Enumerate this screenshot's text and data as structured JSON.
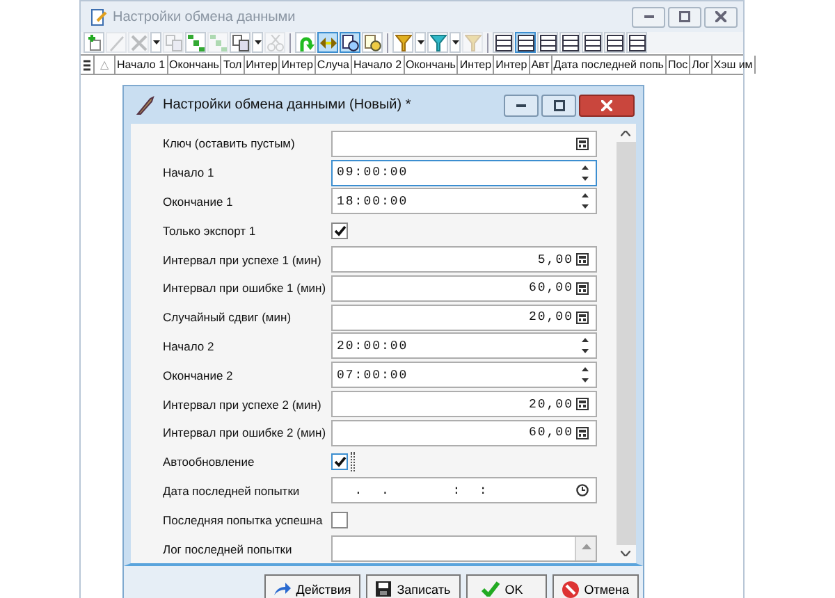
{
  "main_window": {
    "title": "Настройки обмена данными"
  },
  "toolbar_groups": [
    {
      "items": [
        {
          "kind": "add",
          "disabled": false,
          "pressed": false
        },
        {
          "kind": "edit",
          "disabled": true,
          "pressed": false
        },
        {
          "kind": "delete",
          "disabled": true,
          "pressed": false
        },
        {
          "kind": "caret",
          "disabled": false,
          "pressed": false
        },
        {
          "kind": "copy",
          "disabled": true,
          "pressed": false
        },
        {
          "kind": "tree",
          "disabled": false,
          "pressed": false
        },
        {
          "kind": "tree",
          "disabled": true,
          "pressed": false
        },
        {
          "kind": "copy",
          "disabled": false,
          "pressed": false
        },
        {
          "kind": "caret",
          "disabled": false,
          "pressed": false
        },
        {
          "kind": "cut",
          "disabled": true,
          "pressed": false
        }
      ]
    },
    {
      "items": [
        {
          "kind": "refresh",
          "disabled": false,
          "pressed": false
        },
        {
          "kind": "link",
          "disabled": false,
          "pressed": true
        },
        {
          "kind": "find",
          "disabled": false,
          "pressed": true
        },
        {
          "kind": "search-doc",
          "disabled": false,
          "pressed": false
        }
      ]
    },
    {
      "items": [
        {
          "kind": "filter",
          "disabled": false,
          "pressed": false
        },
        {
          "kind": "caret",
          "disabled": false,
          "pressed": false
        },
        {
          "kind": "filter-cyan",
          "disabled": false,
          "pressed": false
        },
        {
          "kind": "caret",
          "disabled": false,
          "pressed": false
        },
        {
          "kind": "filter",
          "disabled": true,
          "pressed": false
        }
      ]
    },
    {
      "items": [
        {
          "kind": "layout",
          "disabled": false,
          "pressed": false
        },
        {
          "kind": "layout",
          "disabled": false,
          "pressed": true
        },
        {
          "kind": "layout",
          "disabled": false,
          "pressed": false
        },
        {
          "kind": "layout",
          "disabled": false,
          "pressed": false
        },
        {
          "kind": "layout",
          "disabled": false,
          "pressed": false
        },
        {
          "kind": "layout",
          "disabled": false,
          "pressed": false
        },
        {
          "kind": "layout",
          "disabled": false,
          "pressed": false
        }
      ]
    }
  ],
  "columns": [
    "△",
    "Начало 1",
    "Окончань",
    "Тол",
    "Интер",
    "Интер",
    "Случа",
    "Начало 2",
    "Окончань",
    "Интер",
    "Интер",
    "Авт",
    "Дата последней попь",
    "Пос",
    "Лог",
    "Хэш им"
  ],
  "dialog": {
    "title": "Настройки обмена данными (Новый) *",
    "fields": [
      {
        "label": "Ключ (оставить пустым)",
        "kind": "text",
        "focused": false
      },
      {
        "label": "Начало 1",
        "kind": "time",
        "value": "09:00:00",
        "focused": true
      },
      {
        "label": "Окончание 1",
        "kind": "time",
        "value": "18:00:00",
        "focused": false
      },
      {
        "label": "Только экспорт 1",
        "kind": "checkbox",
        "checked": true,
        "focused": false
      },
      {
        "label": "Интервал при успехе 1 (мин)",
        "kind": "number",
        "value": "5,00",
        "focused": false
      },
      {
        "label": "Интервал при ошибке 1 (мин)",
        "kind": "number",
        "value": "60,00",
        "focused": false
      },
      {
        "label": "Случайный сдвиг (мин)",
        "kind": "number",
        "value": "20,00",
        "focused": false
      },
      {
        "label": "Начало 2",
        "kind": "time",
        "value": "20:00:00",
        "focused": false
      },
      {
        "label": "Окончание 2",
        "kind": "time",
        "value": "07:00:00",
        "focused": false
      },
      {
        "label": "Интервал при успехе 2 (мин)",
        "kind": "number",
        "value": "20,00",
        "focused": false
      },
      {
        "label": "Интервал при ошибке 2 (мин)",
        "kind": "number",
        "value": "60,00",
        "focused": false
      },
      {
        "label": "Автообновление",
        "kind": "checkbox",
        "checked": true,
        "focused": true
      },
      {
        "label": "Дата последней попытки",
        "kind": "datetime",
        "value": "  .  .       :  :",
        "focused": false
      },
      {
        "label": "Последняя попытка успешна",
        "kind": "checkbox",
        "checked": false,
        "focused": false
      },
      {
        "label": "Лог последней попытки",
        "kind": "memo",
        "focused": false
      }
    ],
    "buttons": [
      {
        "label": "Действия",
        "kind": "actions"
      },
      {
        "label": "Записать",
        "kind": "save"
      },
      {
        "label": "OK",
        "kind": "ok"
      },
      {
        "label": "Отмена",
        "kind": "cancel"
      }
    ]
  }
}
